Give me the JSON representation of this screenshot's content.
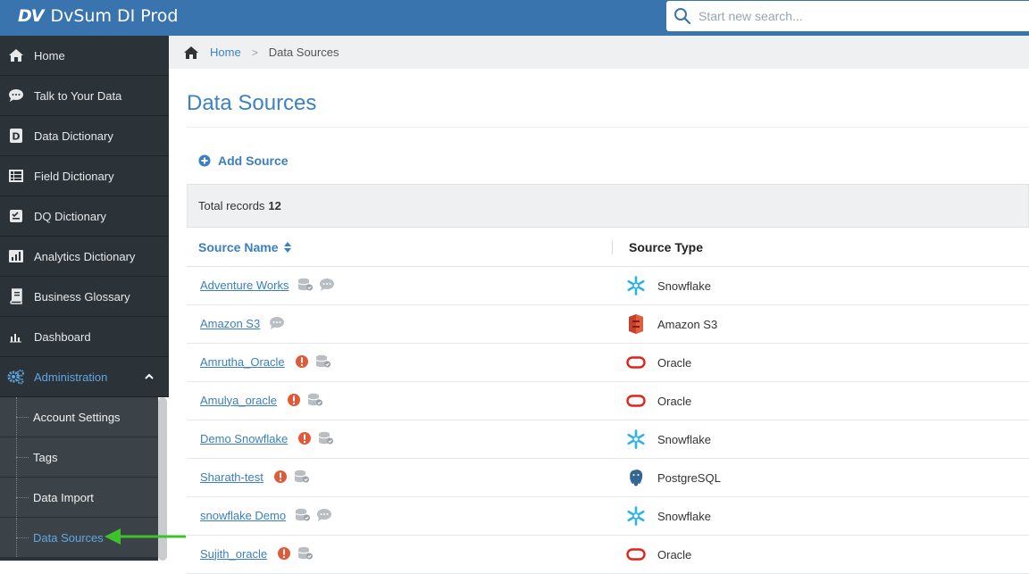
{
  "app": {
    "logo": "DV",
    "title": "DvSum DI Prod"
  },
  "search": {
    "placeholder": "Start new search..."
  },
  "sidebar": {
    "items": [
      {
        "label": "Home",
        "icon": "home-icon"
      },
      {
        "label": "Talk to Your Data",
        "icon": "chat-icon"
      },
      {
        "label": "Data Dictionary",
        "icon": "dictionary-icon"
      },
      {
        "label": "Field Dictionary",
        "icon": "field-icon"
      },
      {
        "label": "DQ Dictionary",
        "icon": "dq-icon"
      },
      {
        "label": "Analytics Dictionary",
        "icon": "analytics-icon"
      },
      {
        "label": "Business Glossary",
        "icon": "book-icon"
      },
      {
        "label": "Dashboard",
        "icon": "bar-chart-icon"
      },
      {
        "label": "Administration",
        "icon": "gears-icon"
      }
    ],
    "sub_items": [
      {
        "label": "Account Settings"
      },
      {
        "label": "Tags"
      },
      {
        "label": "Data Import"
      },
      {
        "label": "Data Sources"
      }
    ]
  },
  "breadcrumb": {
    "home": "Home",
    "separator": ">",
    "current": "Data Sources"
  },
  "page": {
    "title": "Data Sources",
    "add_source_label": "Add Source",
    "records_label": "Total records",
    "records_count": "12"
  },
  "table": {
    "columns": {
      "name": "Source Name",
      "type": "Source Type"
    },
    "rows": [
      {
        "name": "Adventure Works",
        "type": "Snowflake"
      },
      {
        "name": "Amazon S3",
        "type": "Amazon S3"
      },
      {
        "name": "Amrutha_Oracle",
        "type": "Oracle"
      },
      {
        "name": "Amulya_oracle",
        "type": "Oracle"
      },
      {
        "name": "Demo Snowflake",
        "type": "Snowflake"
      },
      {
        "name": "Sharath-test",
        "type": "PostgreSQL"
      },
      {
        "name": "snowflake Demo",
        "type": "Snowflake"
      },
      {
        "name": "Sujith_oracle",
        "type": "Oracle"
      }
    ]
  },
  "colors": {
    "accent": "#3a74ae",
    "link": "#3a7fbf",
    "alert": "#e05a3a",
    "sidebar": "#2c3338",
    "arrow": "#3ec22b"
  }
}
